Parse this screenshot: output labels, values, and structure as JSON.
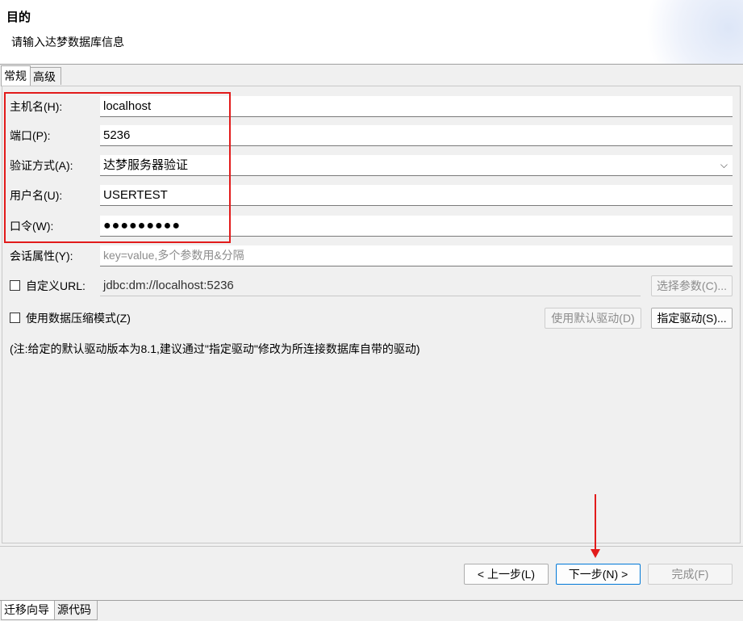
{
  "header": {
    "title": "目的",
    "description": "请输入达梦数据库信息"
  },
  "tabs": [
    {
      "label": "常规",
      "active": true
    },
    {
      "label": "高级",
      "active": false
    }
  ],
  "form": {
    "host_label": "主机名(H):",
    "host_value": "localhost",
    "port_label": "端口(P):",
    "port_value": "5236",
    "auth_label": "验证方式(A):",
    "auth_value": "达梦服务器验证",
    "user_label": "用户名(U):",
    "user_value": "USERTEST",
    "password_label": "口令(W):",
    "password_value": "●●●●●●●●●",
    "session_label": "会话属性(Y):",
    "session_placeholder": "key=value,多个参数用&分隔",
    "custom_url_label": "自定义URL:",
    "custom_url_checked": false,
    "url_value": "jdbc:dm://localhost:5236",
    "select_params_button": "选择参数(C)...",
    "compress_label": "使用数据压缩模式(Z)",
    "compress_checked": false,
    "default_driver_button": "使用默认驱动(D)",
    "specify_driver_button": "指定驱动(S)...",
    "note": "(注:给定的默认驱动版本为8.1,建议通过\"指定驱动\"修改为所连接数据库自带的驱动)"
  },
  "buttons": {
    "back": "< 上一步(L)",
    "next": "下一步(N) >",
    "finish": "完成(F)"
  },
  "bottom_tabs": [
    {
      "label": "迁移向导",
      "active": true
    },
    {
      "label": "源代码",
      "active": false
    }
  ],
  "colors": {
    "annotation": "#e21b1b",
    "focus_border": "#0078d7"
  }
}
